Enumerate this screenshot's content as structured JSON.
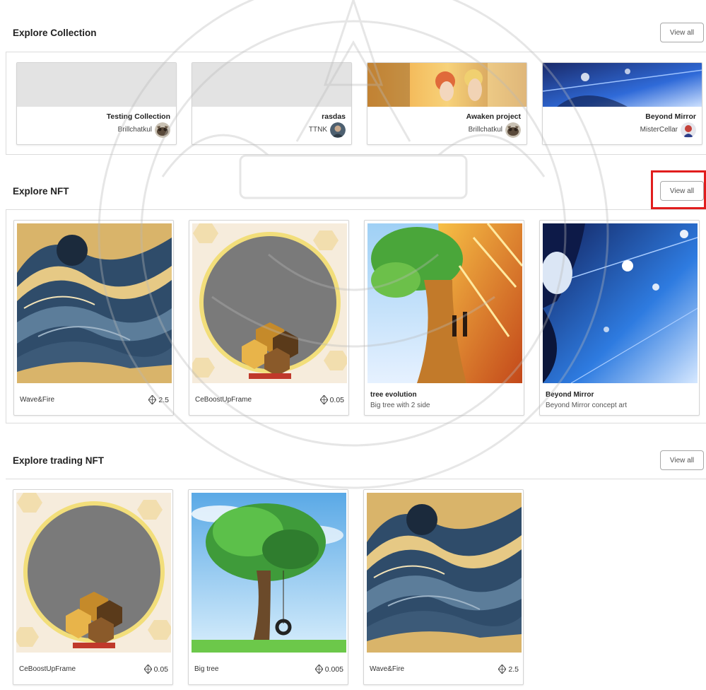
{
  "sections": {
    "collection": {
      "title": "Explore Collection",
      "view_all": "View all"
    },
    "nft": {
      "title": "Explore NFT",
      "view_all": "View all"
    },
    "trading": {
      "title": "Explore trading NFT",
      "view_all": "View all"
    }
  },
  "collections": [
    {
      "name": "Testing Collection",
      "owner": "Brillchatkul",
      "avatar": "cat-avatar"
    },
    {
      "name": "rasdas",
      "owner": "TTNK",
      "avatar": "person-avatar"
    },
    {
      "name": "Awaken project",
      "owner": "Brillchatkul",
      "avatar": "cat-avatar"
    },
    {
      "name": "Beyond Mirror",
      "owner": "MisterCellar",
      "avatar": "character-avatar"
    }
  ],
  "nfts": [
    {
      "name": "Wave&Fire",
      "price": "2.5",
      "description": ""
    },
    {
      "name": "CeBoostUpFrame",
      "price": "0.05",
      "description": ""
    },
    {
      "name": "tree evolution",
      "price": "",
      "description": "Big tree with 2 side"
    },
    {
      "name": "Beyond Mirror",
      "price": "",
      "description": "Beyond Mirror concept art"
    }
  ],
  "trading": [
    {
      "name": "CeBoostUpFrame",
      "price": "0.05"
    },
    {
      "name": "Big tree",
      "price": "0.005"
    },
    {
      "name": "Wave&Fire",
      "price": "2.5"
    }
  ],
  "colors": {
    "highlight": "#e11d1d",
    "border": "#dcdcdc",
    "wave_blue": "#3a5a78",
    "wave_gold": "#d9b46a",
    "frame_yellow": "#f2de7a"
  }
}
